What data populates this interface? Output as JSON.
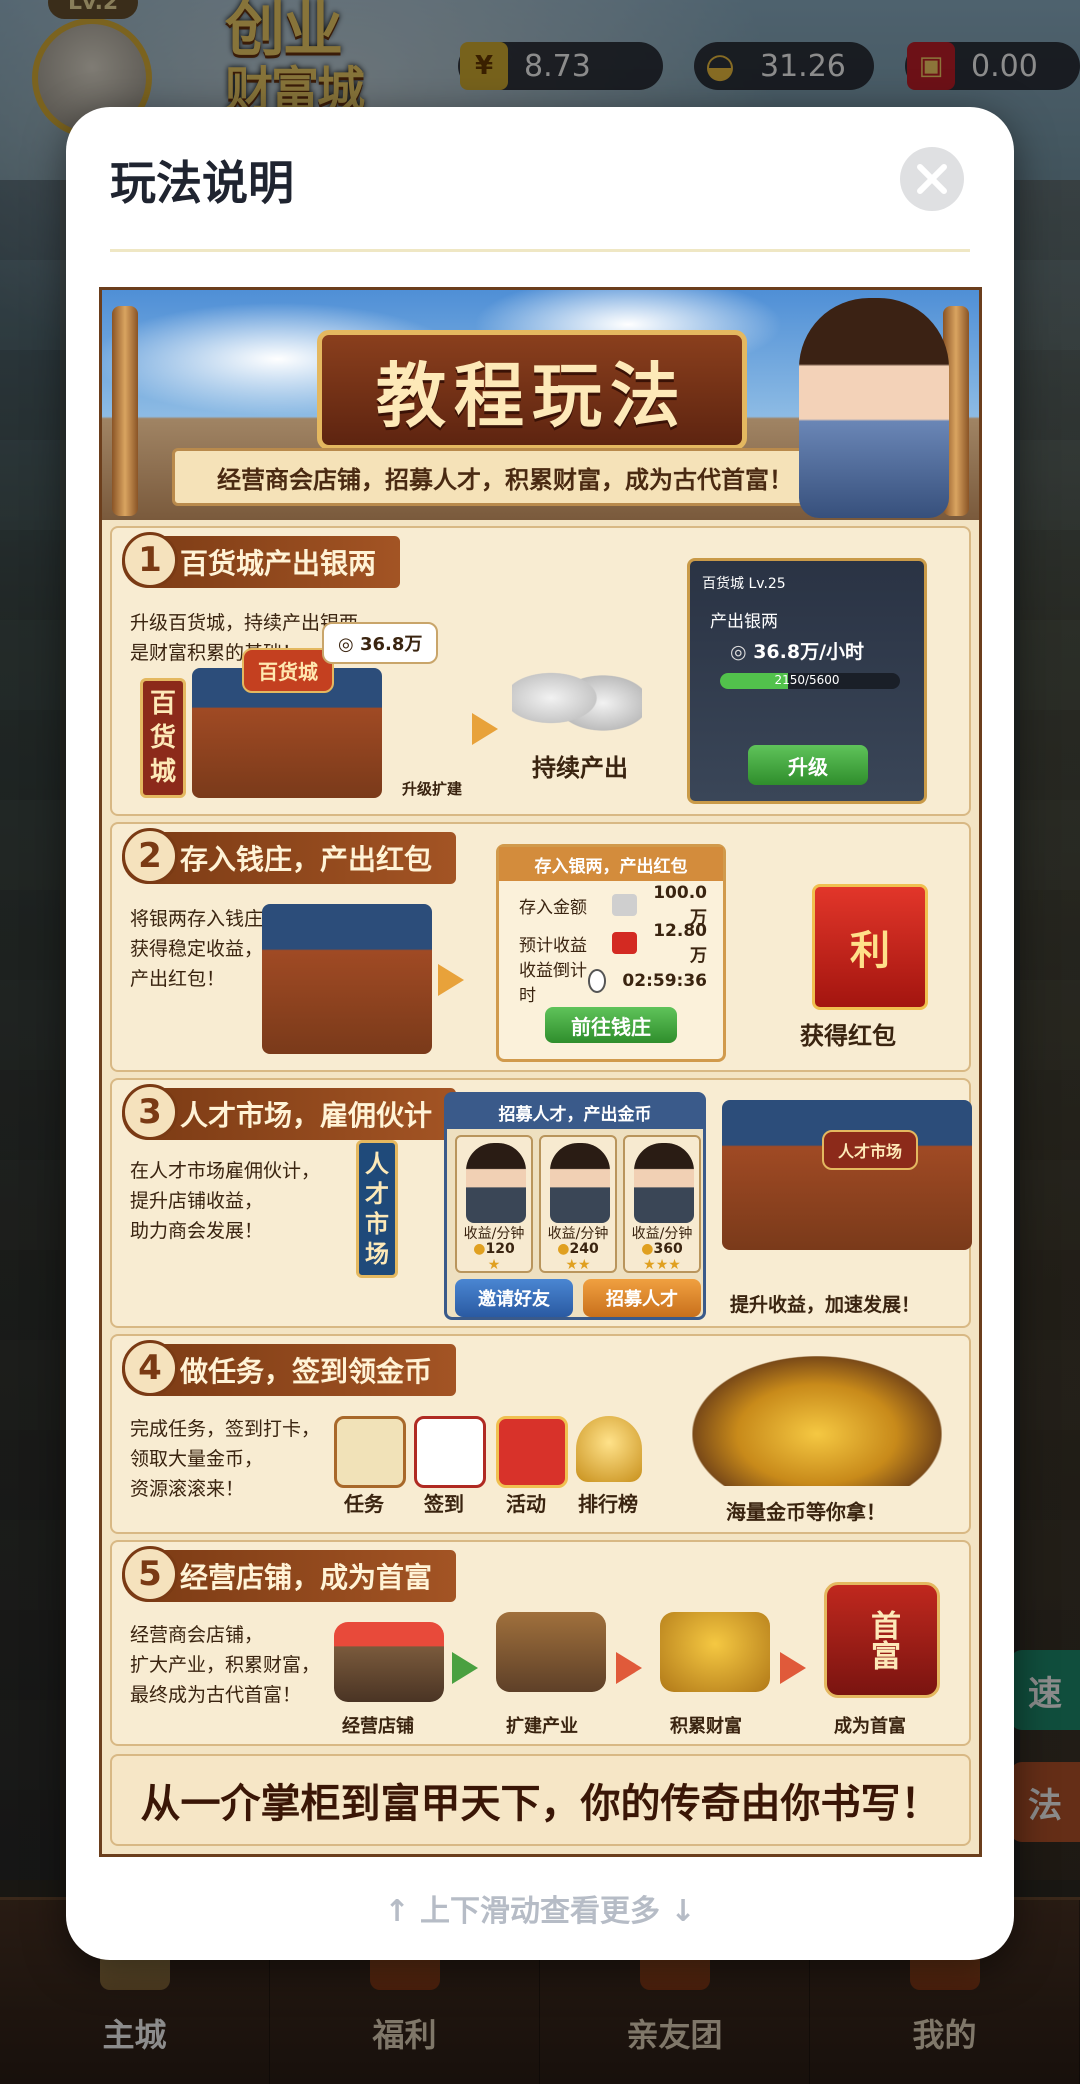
{
  "hud": {
    "level": "Lv.2",
    "logo_line1": "创业",
    "logo_line2": "财富城",
    "currencies": [
      {
        "icon": "silver-coin-icon",
        "value": "8.73"
      },
      {
        "icon": "gold-ingot-icon",
        "value": "31.26"
      },
      {
        "icon": "red-packet-icon",
        "value": "0.00"
      }
    ]
  },
  "modal": {
    "title": "玩法说明",
    "scroll_hint": "↑  上下滑动查看更多  ↓"
  },
  "tutorial": {
    "banner_title": "教程玩法",
    "banner_subtitle": "经营商会店铺，招募人才，积累财富，成为古代首富！",
    "sections": [
      {
        "num": "1",
        "title": "百货城产出银两",
        "desc": "升级百货城，持续产出银两，\n是财富积累的基础！",
        "tag": "百货城",
        "sign": "百货城",
        "bubble": "36.8万",
        "upgrade_build": "升级扩建",
        "output_label": "持续产出",
        "card": {
          "name": "百货城 Lv.25",
          "produce_label": "产出银两",
          "rate": "36.8万/小时",
          "progress_text": "2150/5600",
          "progress": 0.38,
          "button": "升级"
        }
      },
      {
        "num": "2",
        "title": "存入钱庄，产出红包",
        "desc": "将银两存入钱庄，\n获得稳定收益，\n产出红包！",
        "card": {
          "header": "存入银两，产出红包",
          "rows": [
            {
              "k": "存入金额",
              "v": "100.0万"
            },
            {
              "k": "预计收益",
              "v": "12.80万"
            },
            {
              "k": "收益倒计时",
              "v": "02:59:36"
            }
          ],
          "button": "前往钱庄"
        },
        "packet_char": "利",
        "reward_label": "获得红包"
      },
      {
        "num": "3",
        "title": "人才市场，雇佣伙计",
        "desc": "在人才市场雇佣伙计，\n提升店铺收益，\n助力商会发展！",
        "tag": "人才市场",
        "panel_header": "招募人才，产出金币",
        "talents": [
          {
            "label": "收益/分钟",
            "value": "120",
            "stars": "★"
          },
          {
            "label": "收益/分钟",
            "value": "240",
            "stars": "★★"
          },
          {
            "label": "收益/分钟",
            "value": "360",
            "stars": "★★★"
          }
        ],
        "invite_btn": "邀请好友",
        "recruit_btn": "招募人才",
        "market_sign": "人才市场",
        "caption": "提升收益，加速发展！"
      },
      {
        "num": "4",
        "title": "做任务，签到领金币",
        "desc": "完成任务，签到打卡，\n领取大量金币，\n资源滚滚来！",
        "icons": [
          "任务",
          "签到",
          "活动",
          "排行榜"
        ],
        "caption": "海量金币等你拿！"
      },
      {
        "num": "5",
        "title": "经营店铺，成为首富",
        "desc": "经营商会店铺，\n扩大产业，积累财富，\n最终成为古代首富！",
        "steps": [
          "经营店铺",
          "扩建产业",
          "积累财富",
          "成为首富"
        ],
        "plaque": "首富"
      }
    ],
    "footer": "从一介掌柜到富甲天下，你的传奇由你书写！"
  },
  "side_buttons": [
    "速",
    "法"
  ],
  "bottom_nav": [
    "主城",
    "福利",
    "亲友团",
    "我的"
  ],
  "colors": {
    "accent_brown": "#7a3a14",
    "gold": "#e4b860",
    "green": "#52c24c"
  }
}
